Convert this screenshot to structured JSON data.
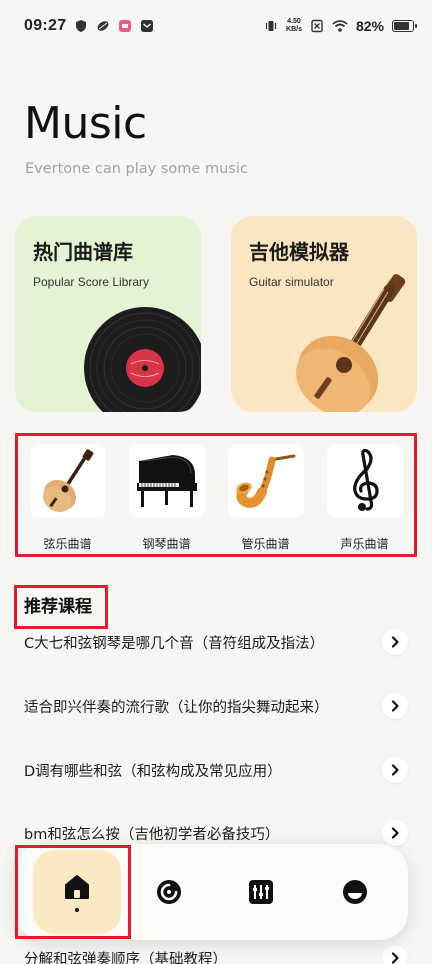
{
  "status_bar": {
    "time": "09:27",
    "net_speed_value": "4.50",
    "net_speed_unit": "KB/s",
    "battery": "82%",
    "battery_level": 0.82
  },
  "header": {
    "title": "Music",
    "subtitle": "Evertone can play some music"
  },
  "cards": [
    {
      "title": "热门曲谱库",
      "subtitle": "Popular Score Library",
      "color": "#e3f3d3"
    },
    {
      "title": "吉他模拟器",
      "subtitle": "Guitar simulator",
      "color": "#fbe6c2"
    }
  ],
  "categories": [
    {
      "label": "弦乐曲谱",
      "icon": "guitar-icon"
    },
    {
      "label": "钢琴曲谱",
      "icon": "grand-piano-icon"
    },
    {
      "label": "管乐曲谱",
      "icon": "saxophone-icon"
    },
    {
      "label": "声乐曲谱",
      "icon": "treble-clef-icon"
    }
  ],
  "section": {
    "title": "推荐课程"
  },
  "courses": [
    "C大七和弦钢琴是哪几个音（音符组成及指法）",
    "适合即兴伴奏的流行歌（让你的指尖舞动起来）",
    "D调有哪些和弦（和弦构成及常见应用）",
    "bm和弦怎么按（吉他初学者必备技巧）",
    "分解和弦弹奏顺序（基础教程）"
  ],
  "nav": [
    {
      "icon": "home-icon",
      "active": true
    },
    {
      "icon": "record-icon",
      "active": false
    },
    {
      "icon": "mixer-icon",
      "active": false
    },
    {
      "icon": "profile-icon",
      "active": false
    }
  ],
  "colors": {
    "highlight": "#e8192c",
    "background": "#f8f6f2",
    "nav_active": "#fbe9c3"
  }
}
